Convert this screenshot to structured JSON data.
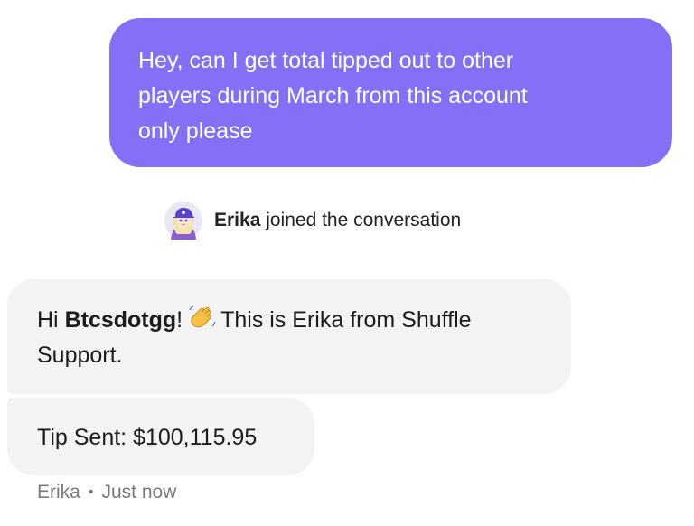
{
  "user_message": {
    "line1": "Hey, can I get total tipped out to other",
    "line2": "players during March from this account",
    "line3": "only please"
  },
  "join_event": {
    "name": "Erika",
    "text": " joined the conversation",
    "avatar_icon": "agent-avatar-icon"
  },
  "agent_message_1": {
    "greeting": "Hi ",
    "username": "Btcsdotgg",
    "exclaim": "!",
    "emoji_icon": "waving-hand-icon",
    "rest_line1": "This is Erika from Shuffle",
    "rest_line2": "Support."
  },
  "agent_message_2": {
    "text": "Tip Sent: $100,115.95"
  },
  "meta": {
    "sender": "Erika",
    "separator": "•",
    "time": "Just now"
  },
  "colors": {
    "user_bubble": "#8470f7",
    "agent_bubble": "#f3f3f3",
    "meta_text": "#7a7a7a"
  }
}
